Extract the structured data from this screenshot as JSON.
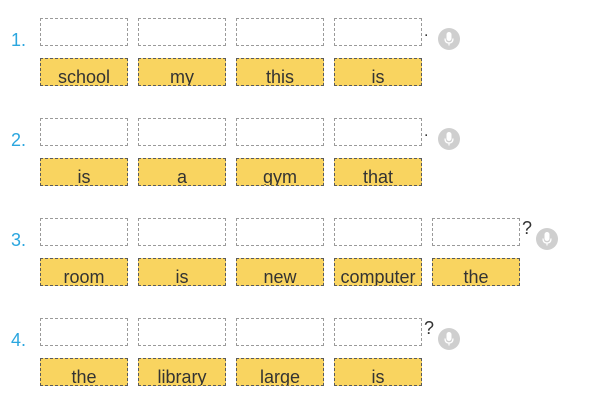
{
  "exercises": [
    {
      "number": "1.",
      "slots": 4,
      "punctuation": ".",
      "words": [
        "school",
        "my",
        "this",
        "is"
      ]
    },
    {
      "number": "2.",
      "slots": 4,
      "punctuation": ".",
      "words": [
        "is",
        "a",
        "gym",
        "that"
      ]
    },
    {
      "number": "3.",
      "slots": 5,
      "punctuation": "?",
      "words": [
        "room",
        "is",
        "new",
        "computer",
        "the"
      ]
    },
    {
      "number": "4.",
      "slots": 4,
      "punctuation": "?",
      "words": [
        "the",
        "library",
        "large",
        "is"
      ]
    }
  ],
  "colors": {
    "number": "#2aa6df",
    "word_tile": "#f9d460",
    "mic_button": "#cfcfcf"
  },
  "icons": {
    "audio": "microphone-icon"
  }
}
